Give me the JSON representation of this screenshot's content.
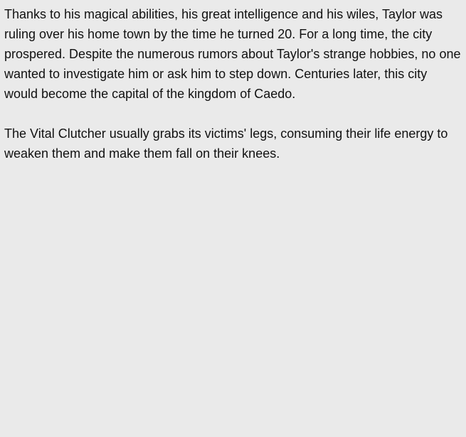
{
  "paragraphs": [
    "Thanks to his magical abilities, his great intelligence and his wiles, Taylor was ruling over his home town by the time he turned 20. For a long time, the city prospered. Despite the numerous rumors about Taylor's strange hobbies, no one wanted to investigate him or ask him to step down. Centuries later, this city would become the capital of the kingdom of Caedo.",
    "The Vital Clutcher usually grabs its victims' legs, consuming their life energy to weaken them and make them fall on their knees."
  ]
}
